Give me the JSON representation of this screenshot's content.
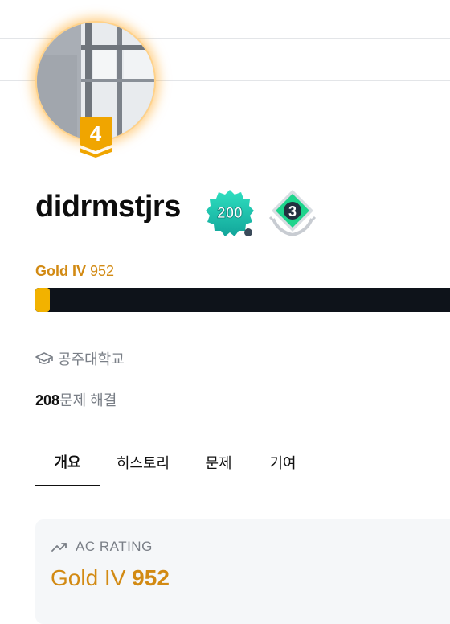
{
  "profile": {
    "username": "didrmstjrs",
    "tier_level": "4",
    "badge_number": "200",
    "class_number": "3"
  },
  "rating": {
    "tier": "Gold IV",
    "value": "952",
    "progress_fraction": 0.035
  },
  "school": {
    "name": "공주대학교",
    "icon": "graduation-cap-icon"
  },
  "solved": {
    "count": "208",
    "label": "문제 해결"
  },
  "tabs": [
    {
      "label": "개요",
      "active": true
    },
    {
      "label": "히스토리",
      "active": false
    },
    {
      "label": "문제",
      "active": false
    },
    {
      "label": "기여",
      "active": false
    }
  ],
  "rating_card": {
    "title": "AC RATING",
    "icon": "trending-up-icon",
    "tier": "Gold IV",
    "value": "952"
  },
  "colors": {
    "gold": "#d28a13",
    "bar_fill": "#f2b200",
    "bar_bg": "#0e131a"
  }
}
